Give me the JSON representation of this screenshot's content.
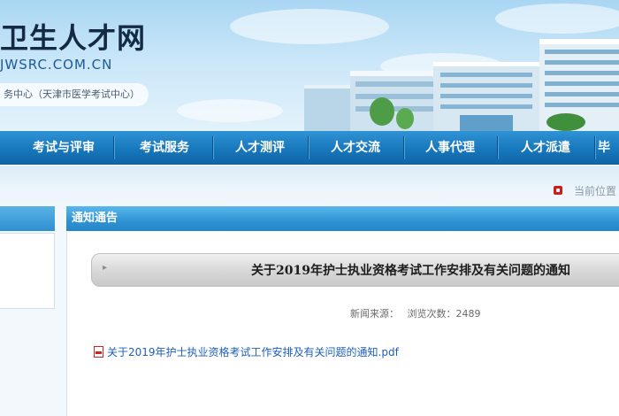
{
  "header": {
    "site_title": "卫生人才网",
    "domain": "JWSRC.COM.CN",
    "subtitle": "务中心（天津市医学考试中心）"
  },
  "nav": {
    "items": [
      {
        "label": "考试与评审"
      },
      {
        "label": "考试服务"
      },
      {
        "label": "人才测评"
      },
      {
        "label": "人才交流"
      },
      {
        "label": "人事代理"
      },
      {
        "label": "人才派遣"
      },
      {
        "label": "毕"
      }
    ]
  },
  "breadcrumb": {
    "label": "当前位置"
  },
  "section": {
    "title": "通知通告"
  },
  "article": {
    "title": "关于2019年护士执业资格考试工作安排及有关问题的通知",
    "source_label": "新闻来源：",
    "views_label": "浏览次数：",
    "views": "2489",
    "attachment": "关于2019年护士执业资格考试工作安排及有关问题的通知.pdf"
  },
  "colors": {
    "nav_blue": "#1878bd",
    "link_blue": "#1e5fb8",
    "location_red": "#c81e1e"
  }
}
